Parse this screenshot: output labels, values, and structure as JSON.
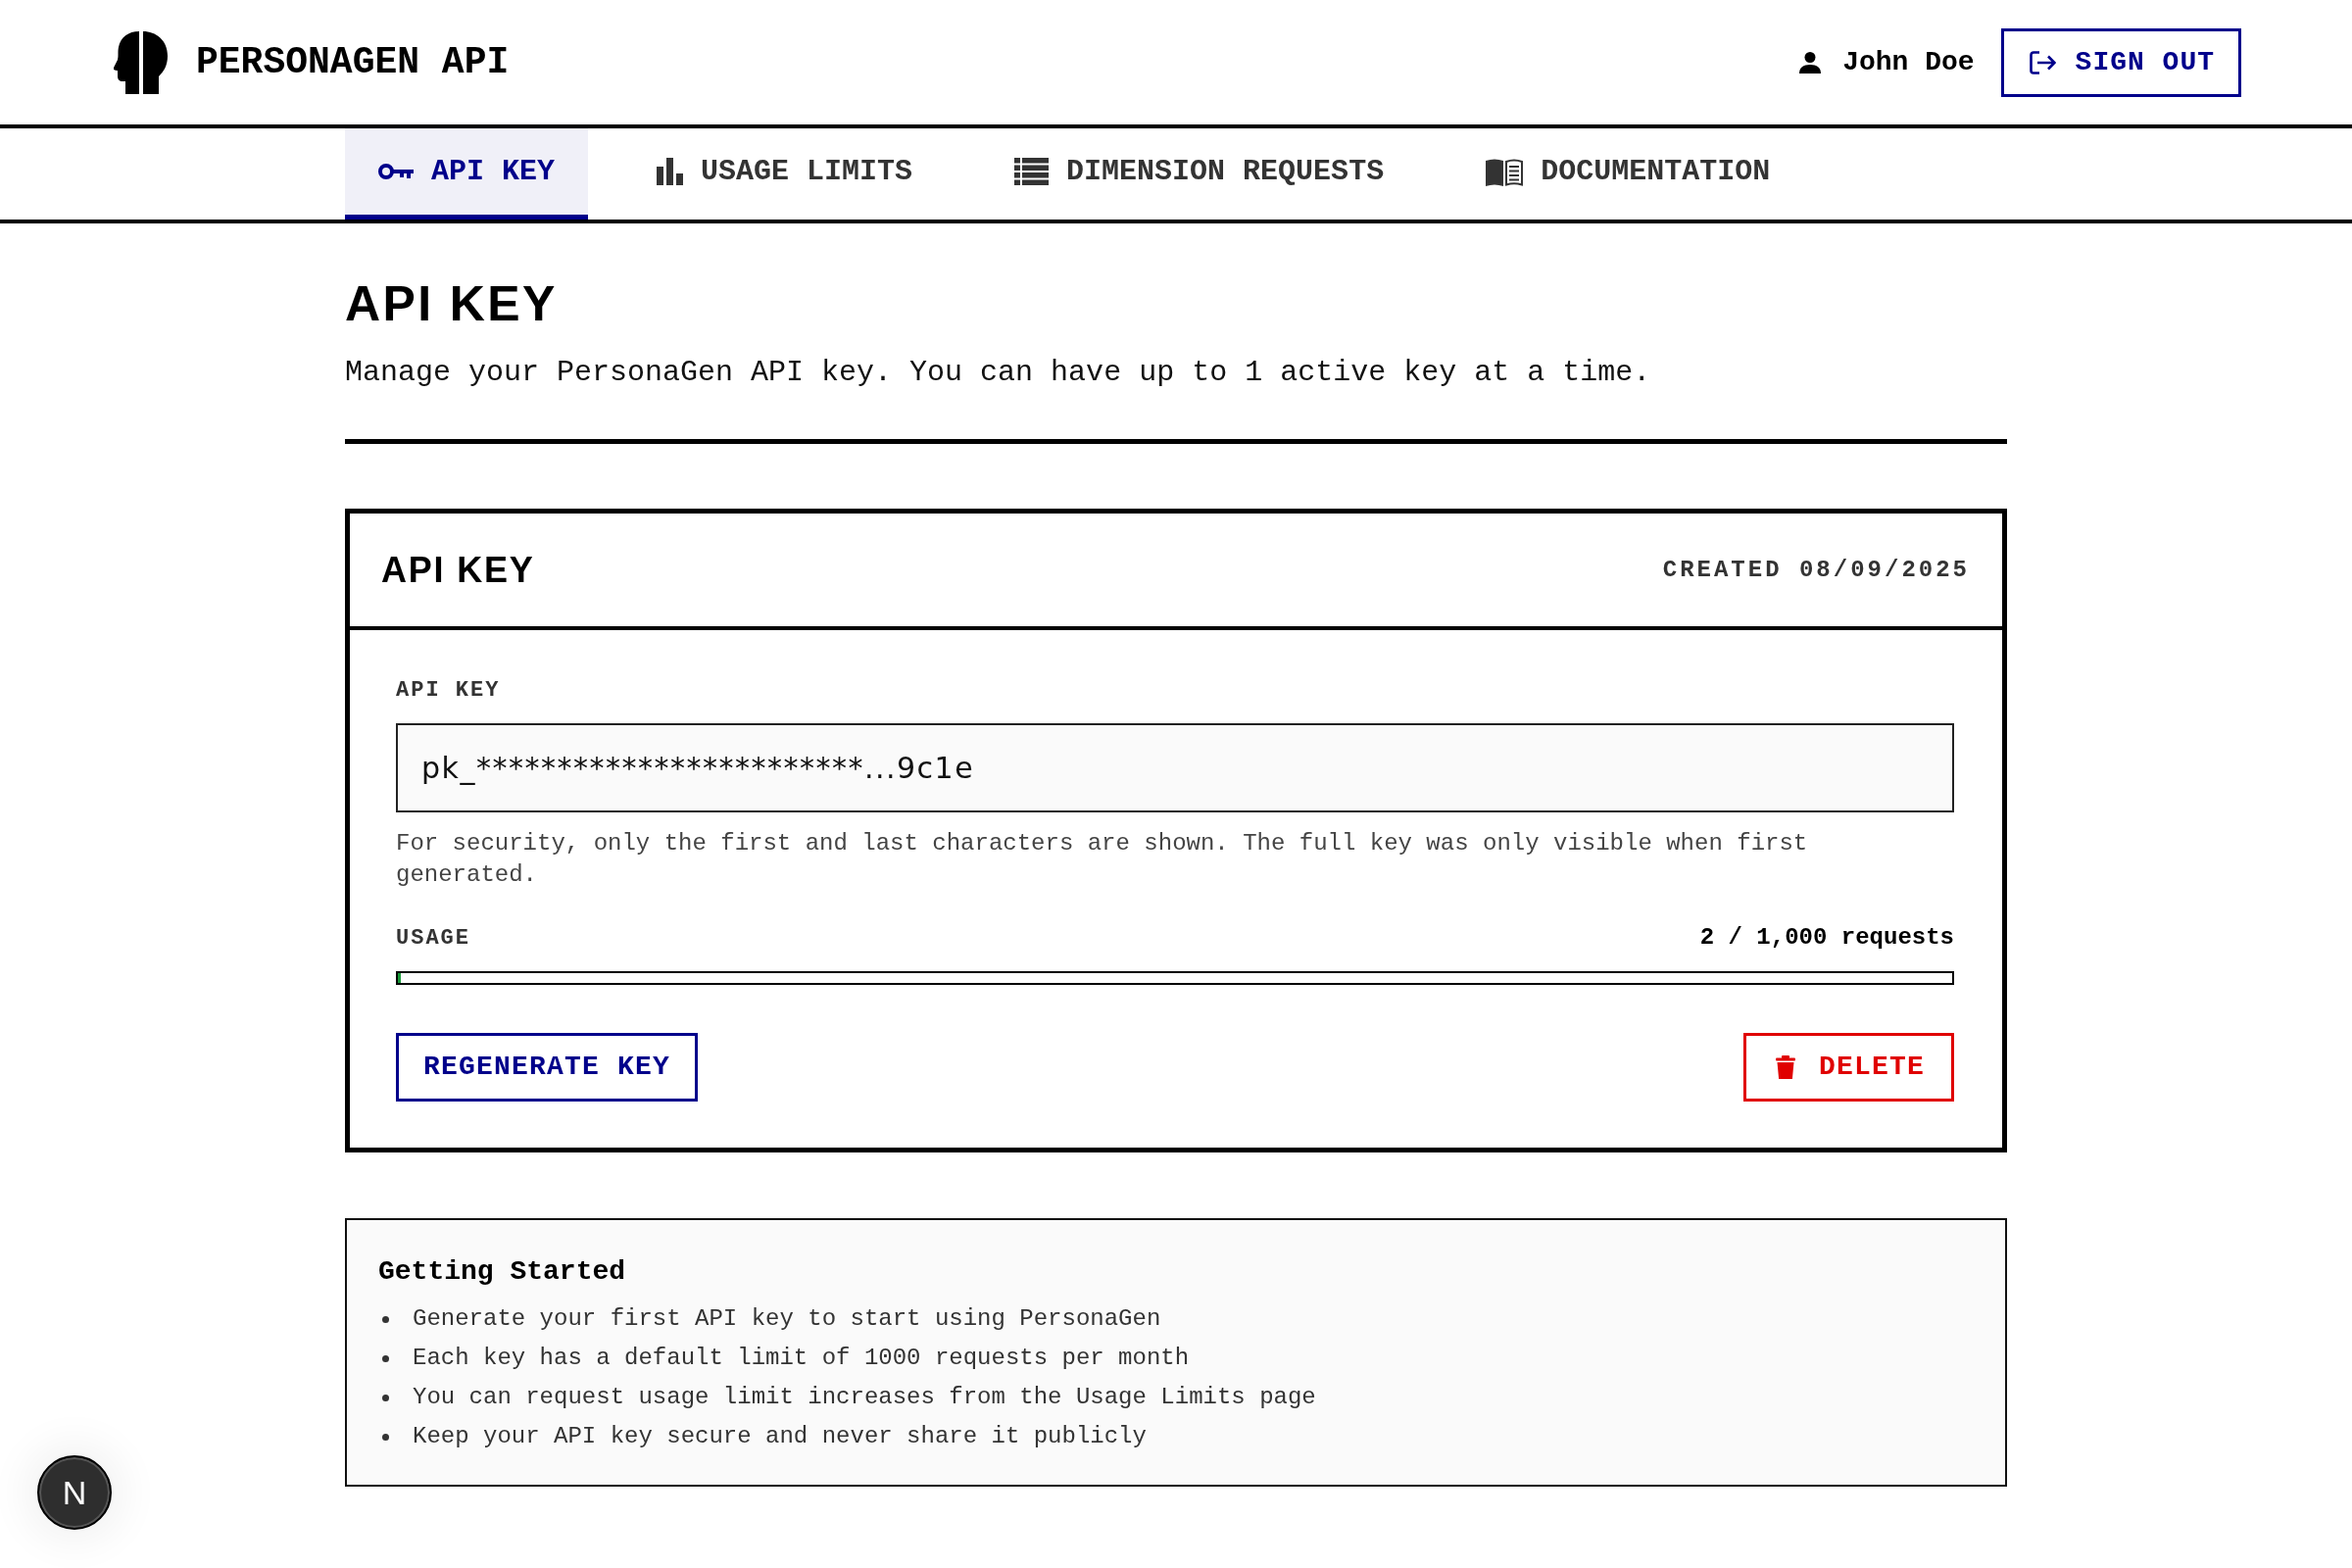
{
  "header": {
    "brand": "PERSONAGEN API",
    "user_name": "John Doe",
    "sign_out": "SIGN OUT"
  },
  "tabs": [
    {
      "label": "API KEY",
      "selected": true
    },
    {
      "label": "USAGE LIMITS",
      "selected": false
    },
    {
      "label": "DIMENSION REQUESTS",
      "selected": false
    },
    {
      "label": "DOCUMENTATION",
      "selected": false
    }
  ],
  "page": {
    "title": "API KEY",
    "subtitle": "Manage your PersonaGen API key. You can have up to 1 active key at a time."
  },
  "api_key_card": {
    "title": "API KEY",
    "created": "CREATED 08/09/2025",
    "field_label": "API KEY",
    "field_value": "pk_************************...9c1e",
    "help": "For security, only the first and last characters are shown. The full key was only visible when first generated.",
    "usage": {
      "label": "USAGE",
      "reading": "2 / 1,000 requests",
      "level": 0.002
    },
    "buttons": [
      {
        "label": "REGENERATE KEY",
        "kind": "primary"
      },
      {
        "label": "DELETE",
        "kind": "danger"
      }
    ]
  },
  "getting_started": {
    "title": "Getting Started",
    "items": [
      "Generate your first API key to start using PersonaGen",
      "Each key has a default limit of 1000 requests per month",
      "You can request usage limit increases from the Usage Limits page",
      "Keep your API key secure and never share it publicly"
    ]
  },
  "dev_indicator": {
    "label": "N"
  }
}
